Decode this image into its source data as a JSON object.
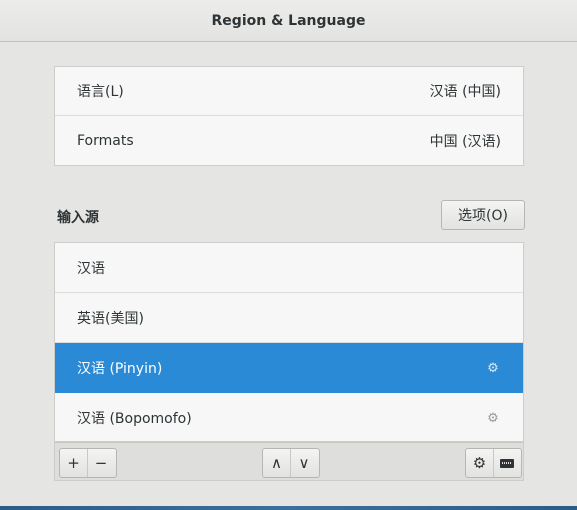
{
  "window": {
    "title": "Region & Language"
  },
  "language_panel": {
    "rows": [
      {
        "label": "语言(L)",
        "value": "汉语 (中国)"
      },
      {
        "label": "Formats",
        "value": "中国 (汉语)"
      }
    ]
  },
  "input_sources": {
    "section_label": "输入源",
    "options_label": "选项(O)",
    "items": [
      {
        "label": "汉语"
      },
      {
        "label": "英语(美国)"
      },
      {
        "label": "汉语 (Pinyin)",
        "selected": true,
        "icon": "gear-icon"
      },
      {
        "label": "汉语 (Bopomofo)",
        "icon": "gear-icon"
      }
    ]
  },
  "toolbar": {
    "add_label": "+",
    "remove_label": "−",
    "up_label": "∧",
    "down_label": "∨"
  },
  "colors": {
    "selection": "#2b8ad6",
    "background": "#e5e5e4"
  }
}
